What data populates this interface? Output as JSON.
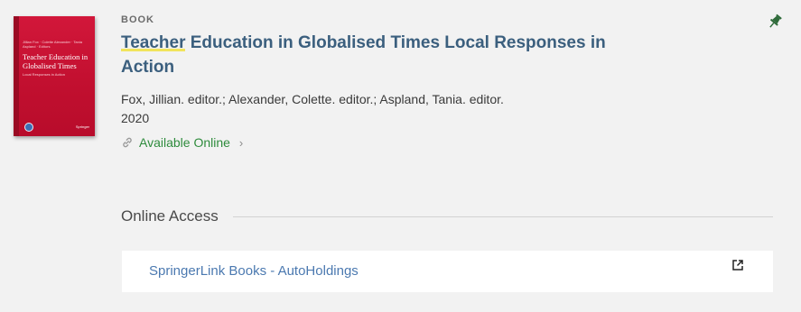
{
  "record": {
    "type": "BOOK",
    "title_highlight": "Teacher",
    "title_rest": " Education in Globalised Times Local Responses in Action",
    "authors": "Fox, Jillian. editor.; Alexander, Colette. editor.; Aspland, Tania. editor.",
    "year": "2020",
    "availability": "Available Online"
  },
  "cover": {
    "authors_line": "Jillian Fox · Colette Alexander · Tania Aspland · Editors",
    "title": "Teacher Education in Globalised Times",
    "subtitle": "Local Responses in Action",
    "publisher": "Springer",
    "color": "#c8123a"
  },
  "online_access": {
    "heading": "Online Access",
    "services": [
      {
        "name": "SpringerLink Books - AutoHoldings"
      }
    ]
  },
  "colors": {
    "title": "#3b5f7e",
    "available": "#2e8b3c",
    "link": "#4b79b0",
    "highlight": "#f1e45c"
  },
  "icons": {
    "pin": "pin-icon",
    "availability": "link-icon",
    "chevron": "chevron-right-icon",
    "external": "external-link-icon"
  }
}
